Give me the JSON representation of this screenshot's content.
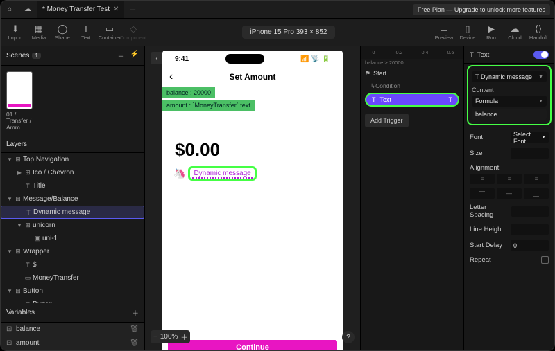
{
  "topbar": {
    "tab_title": "* Money Transfer Test",
    "upgrade": "Free Plan — Upgrade to unlock more features"
  },
  "toolbar": {
    "left": [
      "Import",
      "Media",
      "Shape",
      "Text",
      "Container",
      "Component"
    ],
    "device": "iPhone 15 Pro  393 × 852",
    "right": [
      "Preview",
      "Device",
      "Run",
      "Cloud",
      "Handoff"
    ]
  },
  "scenes": {
    "title": "Scenes",
    "count": "1",
    "item": "01 / Transfer / Amm…"
  },
  "layers": {
    "title": "Layers",
    "rows": [
      {
        "ind": 0,
        "chev": "▼",
        "ico": "⊞",
        "label": "Top Navigation"
      },
      {
        "ind": 1,
        "chev": "▶",
        "ico": "⊞",
        "label": "Ico / Chevron"
      },
      {
        "ind": 1,
        "chev": "",
        "ico": "T",
        "label": "Title"
      },
      {
        "ind": 0,
        "chev": "▼",
        "ico": "⊞",
        "label": "Message/Balance"
      },
      {
        "ind": 1,
        "chev": "",
        "ico": "T",
        "label": "Dynamic message",
        "sel": true
      },
      {
        "ind": 1,
        "chev": "▼",
        "ico": "⊞",
        "label": "unicorn"
      },
      {
        "ind": 2,
        "chev": "",
        "ico": "▣",
        "label": "uni-1"
      },
      {
        "ind": 0,
        "chev": "▼",
        "ico": "⊞",
        "label": "Wrapper"
      },
      {
        "ind": 1,
        "chev": "",
        "ico": "T",
        "label": "$"
      },
      {
        "ind": 1,
        "chev": "",
        "ico": "▭",
        "label": "MoneyTransfer"
      },
      {
        "ind": 0,
        "chev": "▼",
        "ico": "⊞",
        "label": "Button"
      },
      {
        "ind": 1,
        "chev": "",
        "ico": "T",
        "label": "Button"
      }
    ]
  },
  "variables": {
    "title": "Variables",
    "rows": [
      "balance",
      "amount"
    ]
  },
  "phone": {
    "time": "9:41",
    "title": "Set Amount",
    "var1": "balance : 20000",
    "var2": "amount :  `MoneyTransfer`.text",
    "amount": "$0.00",
    "dynamic": "Dynamic message",
    "continue": "Continue"
  },
  "zoom": "100%",
  "timeline": {
    "ruler": [
      "0",
      "0.2",
      "0.4",
      "0.6"
    ],
    "start": "Start",
    "bal": "balance > 20000",
    "cond": "Condition",
    "text": "Text",
    "add": "Add Trigger"
  },
  "inspector": {
    "title": "Text",
    "textval": "Dynamic message",
    "content": "Content",
    "formula": "Formula",
    "formula_val": "balance",
    "font": "Font",
    "font_val": "Select Font",
    "size": "Size",
    "alignment": "Alignment",
    "letter": "Letter Spacing",
    "line": "Line Height",
    "delay": "Start Delay",
    "delay_val": "0",
    "repeat": "Repeat"
  }
}
